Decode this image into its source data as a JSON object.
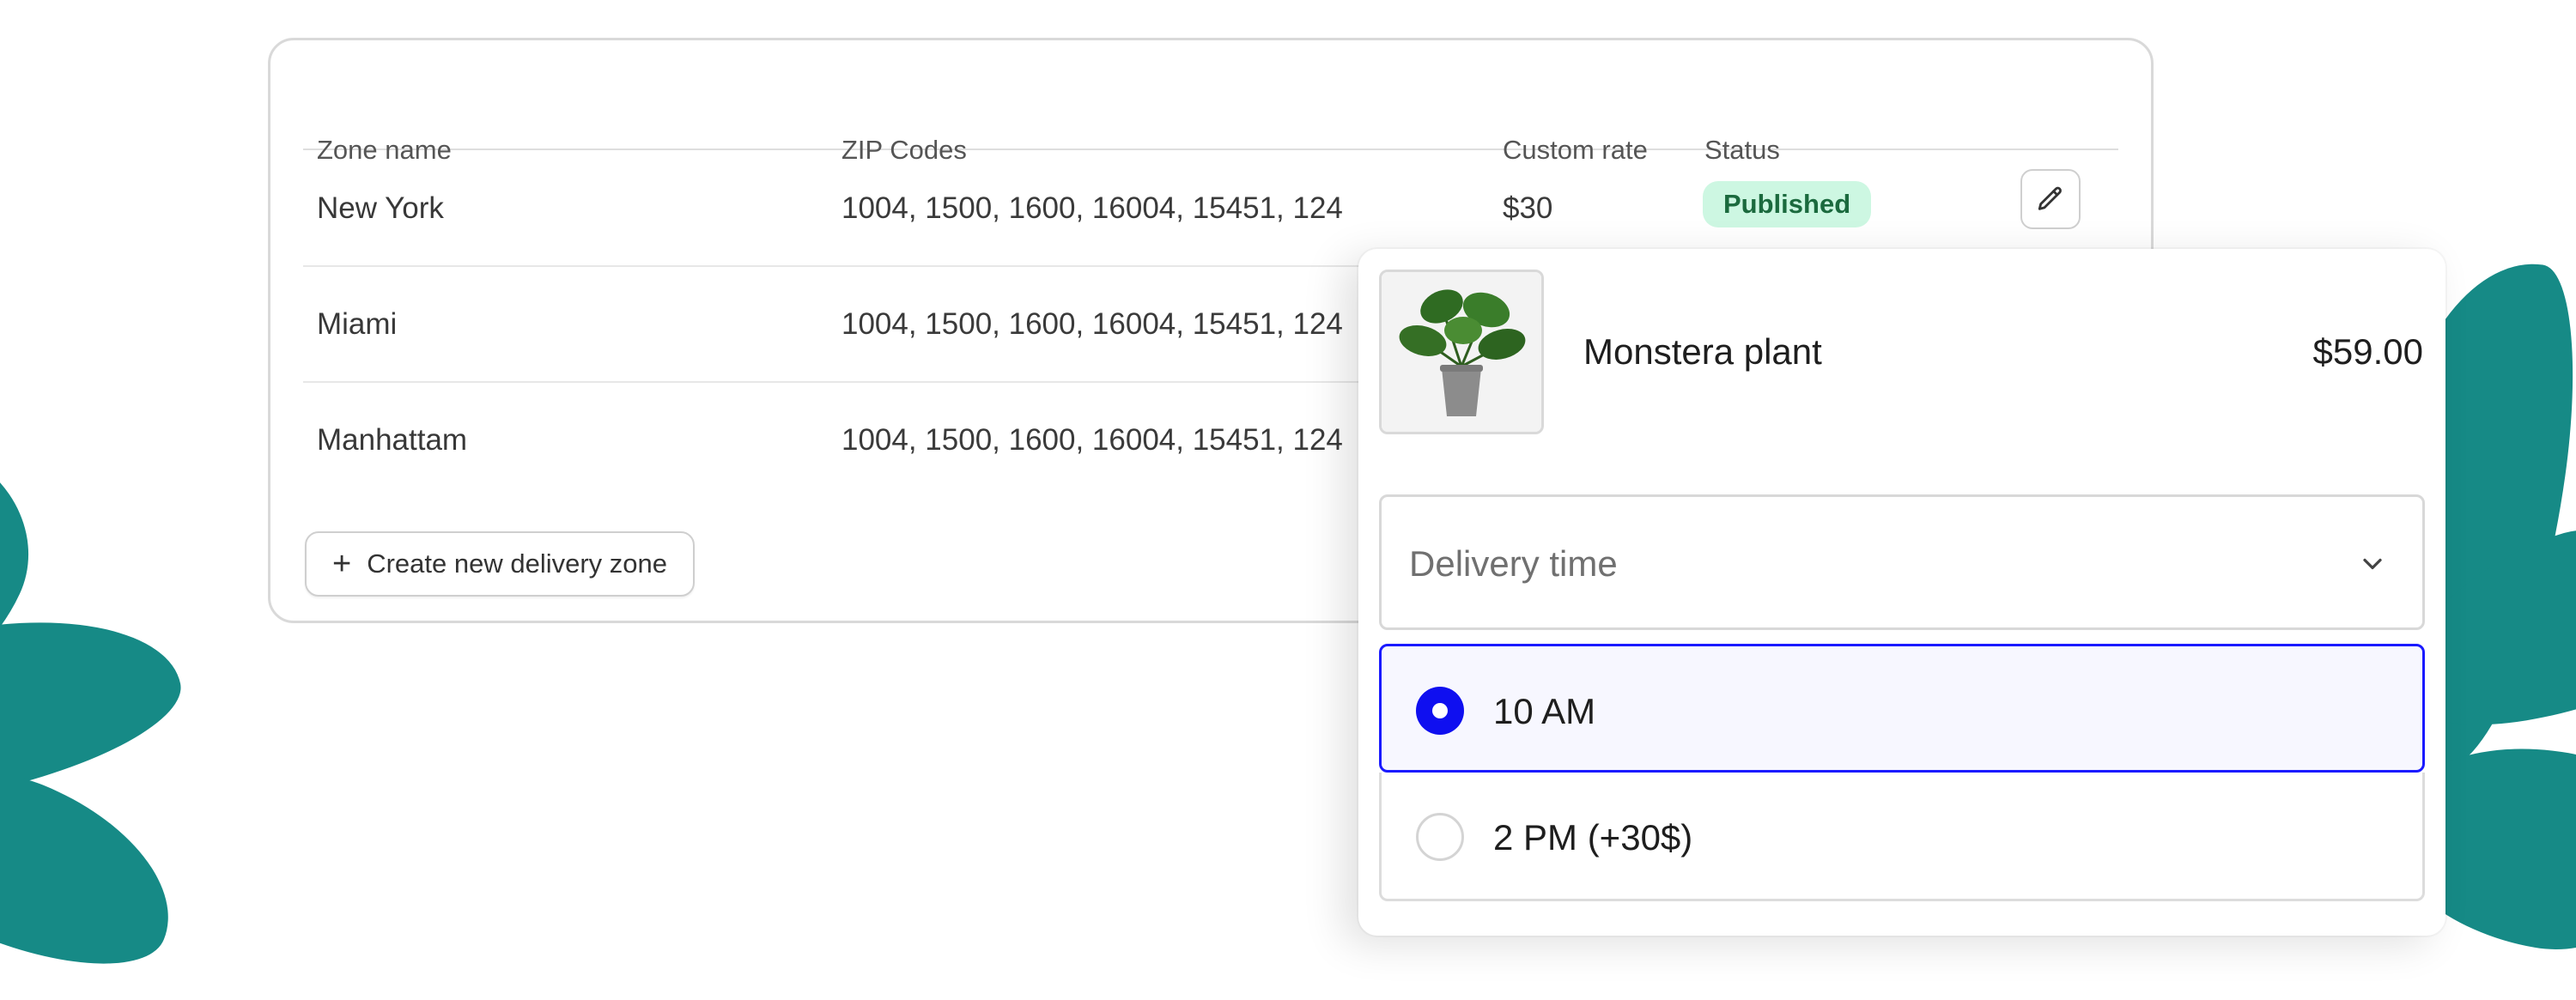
{
  "table": {
    "headers": {
      "zone": "Zone name",
      "zip": "ZIP Codes",
      "rate": "Custom rate",
      "status": "Status"
    },
    "rows": [
      {
        "name": "New York",
        "zips": "1004, 1500, 1600, 16004, 15451, 124",
        "rate": "$30",
        "status": "Published"
      },
      {
        "name": "Miami",
        "zips": "1004, 1500, 1600, 16004, 15451, 124"
      },
      {
        "name": "Manhattam",
        "zips": "1004, 1500, 1600, 16004, 15451, 124"
      }
    ],
    "create_label": "Create new delivery zone"
  },
  "product": {
    "name": "Monstera plant",
    "price": "$59.00",
    "delivery": {
      "placeholder": "Delivery time",
      "options": [
        {
          "label": "10 AM",
          "selected": true
        },
        {
          "label": "2 PM (+30$)",
          "selected": false
        }
      ]
    }
  },
  "colors": {
    "accent": "#0f0ff0",
    "badge_bg": "#cdf7e2",
    "badge_text": "#1b6a3e",
    "leaf": "#168a86"
  },
  "icons": [
    "pencil-icon",
    "plus-icon",
    "chevron-down-icon",
    "plant-image"
  ]
}
